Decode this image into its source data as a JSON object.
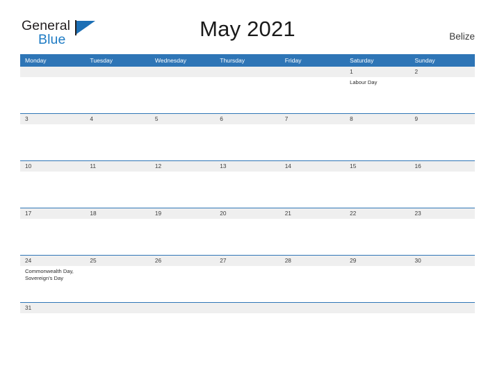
{
  "brand": {
    "name_part1": "General",
    "name_part2": "Blue",
    "flag_icon": "flag-triangle-icon"
  },
  "header": {
    "title": "May 2021",
    "country": "Belize"
  },
  "colors": {
    "header_blue": "#2e75b6",
    "row_gray": "#efefef",
    "separator_blue": "#2e75b6",
    "brand_blue": "#1e7bc4",
    "text_dark": "#2b2b2b"
  },
  "calendar": {
    "weekdays": [
      "Monday",
      "Tuesday",
      "Wednesday",
      "Thursday",
      "Friday",
      "Saturday",
      "Sunday"
    ],
    "weeks": [
      {
        "days": [
          {
            "num": "",
            "event": ""
          },
          {
            "num": "",
            "event": ""
          },
          {
            "num": "",
            "event": ""
          },
          {
            "num": "",
            "event": ""
          },
          {
            "num": "",
            "event": ""
          },
          {
            "num": "1",
            "event": "Labour Day"
          },
          {
            "num": "2",
            "event": ""
          }
        ]
      },
      {
        "days": [
          {
            "num": "3",
            "event": ""
          },
          {
            "num": "4",
            "event": ""
          },
          {
            "num": "5",
            "event": ""
          },
          {
            "num": "6",
            "event": ""
          },
          {
            "num": "7",
            "event": ""
          },
          {
            "num": "8",
            "event": ""
          },
          {
            "num": "9",
            "event": ""
          }
        ]
      },
      {
        "days": [
          {
            "num": "10",
            "event": ""
          },
          {
            "num": "11",
            "event": ""
          },
          {
            "num": "12",
            "event": ""
          },
          {
            "num": "13",
            "event": ""
          },
          {
            "num": "14",
            "event": ""
          },
          {
            "num": "15",
            "event": ""
          },
          {
            "num": "16",
            "event": ""
          }
        ]
      },
      {
        "days": [
          {
            "num": "17",
            "event": ""
          },
          {
            "num": "18",
            "event": ""
          },
          {
            "num": "19",
            "event": ""
          },
          {
            "num": "20",
            "event": ""
          },
          {
            "num": "21",
            "event": ""
          },
          {
            "num": "22",
            "event": ""
          },
          {
            "num": "23",
            "event": ""
          }
        ]
      },
      {
        "days": [
          {
            "num": "24",
            "event": "Commonwealth Day, Sovereign's Day"
          },
          {
            "num": "25",
            "event": ""
          },
          {
            "num": "26",
            "event": ""
          },
          {
            "num": "27",
            "event": ""
          },
          {
            "num": "28",
            "event": ""
          },
          {
            "num": "29",
            "event": ""
          },
          {
            "num": "30",
            "event": ""
          }
        ]
      },
      {
        "days": [
          {
            "num": "31",
            "event": ""
          },
          {
            "num": "",
            "event": ""
          },
          {
            "num": "",
            "event": ""
          },
          {
            "num": "",
            "event": ""
          },
          {
            "num": "",
            "event": ""
          },
          {
            "num": "",
            "event": ""
          },
          {
            "num": "",
            "event": ""
          }
        ]
      }
    ]
  }
}
